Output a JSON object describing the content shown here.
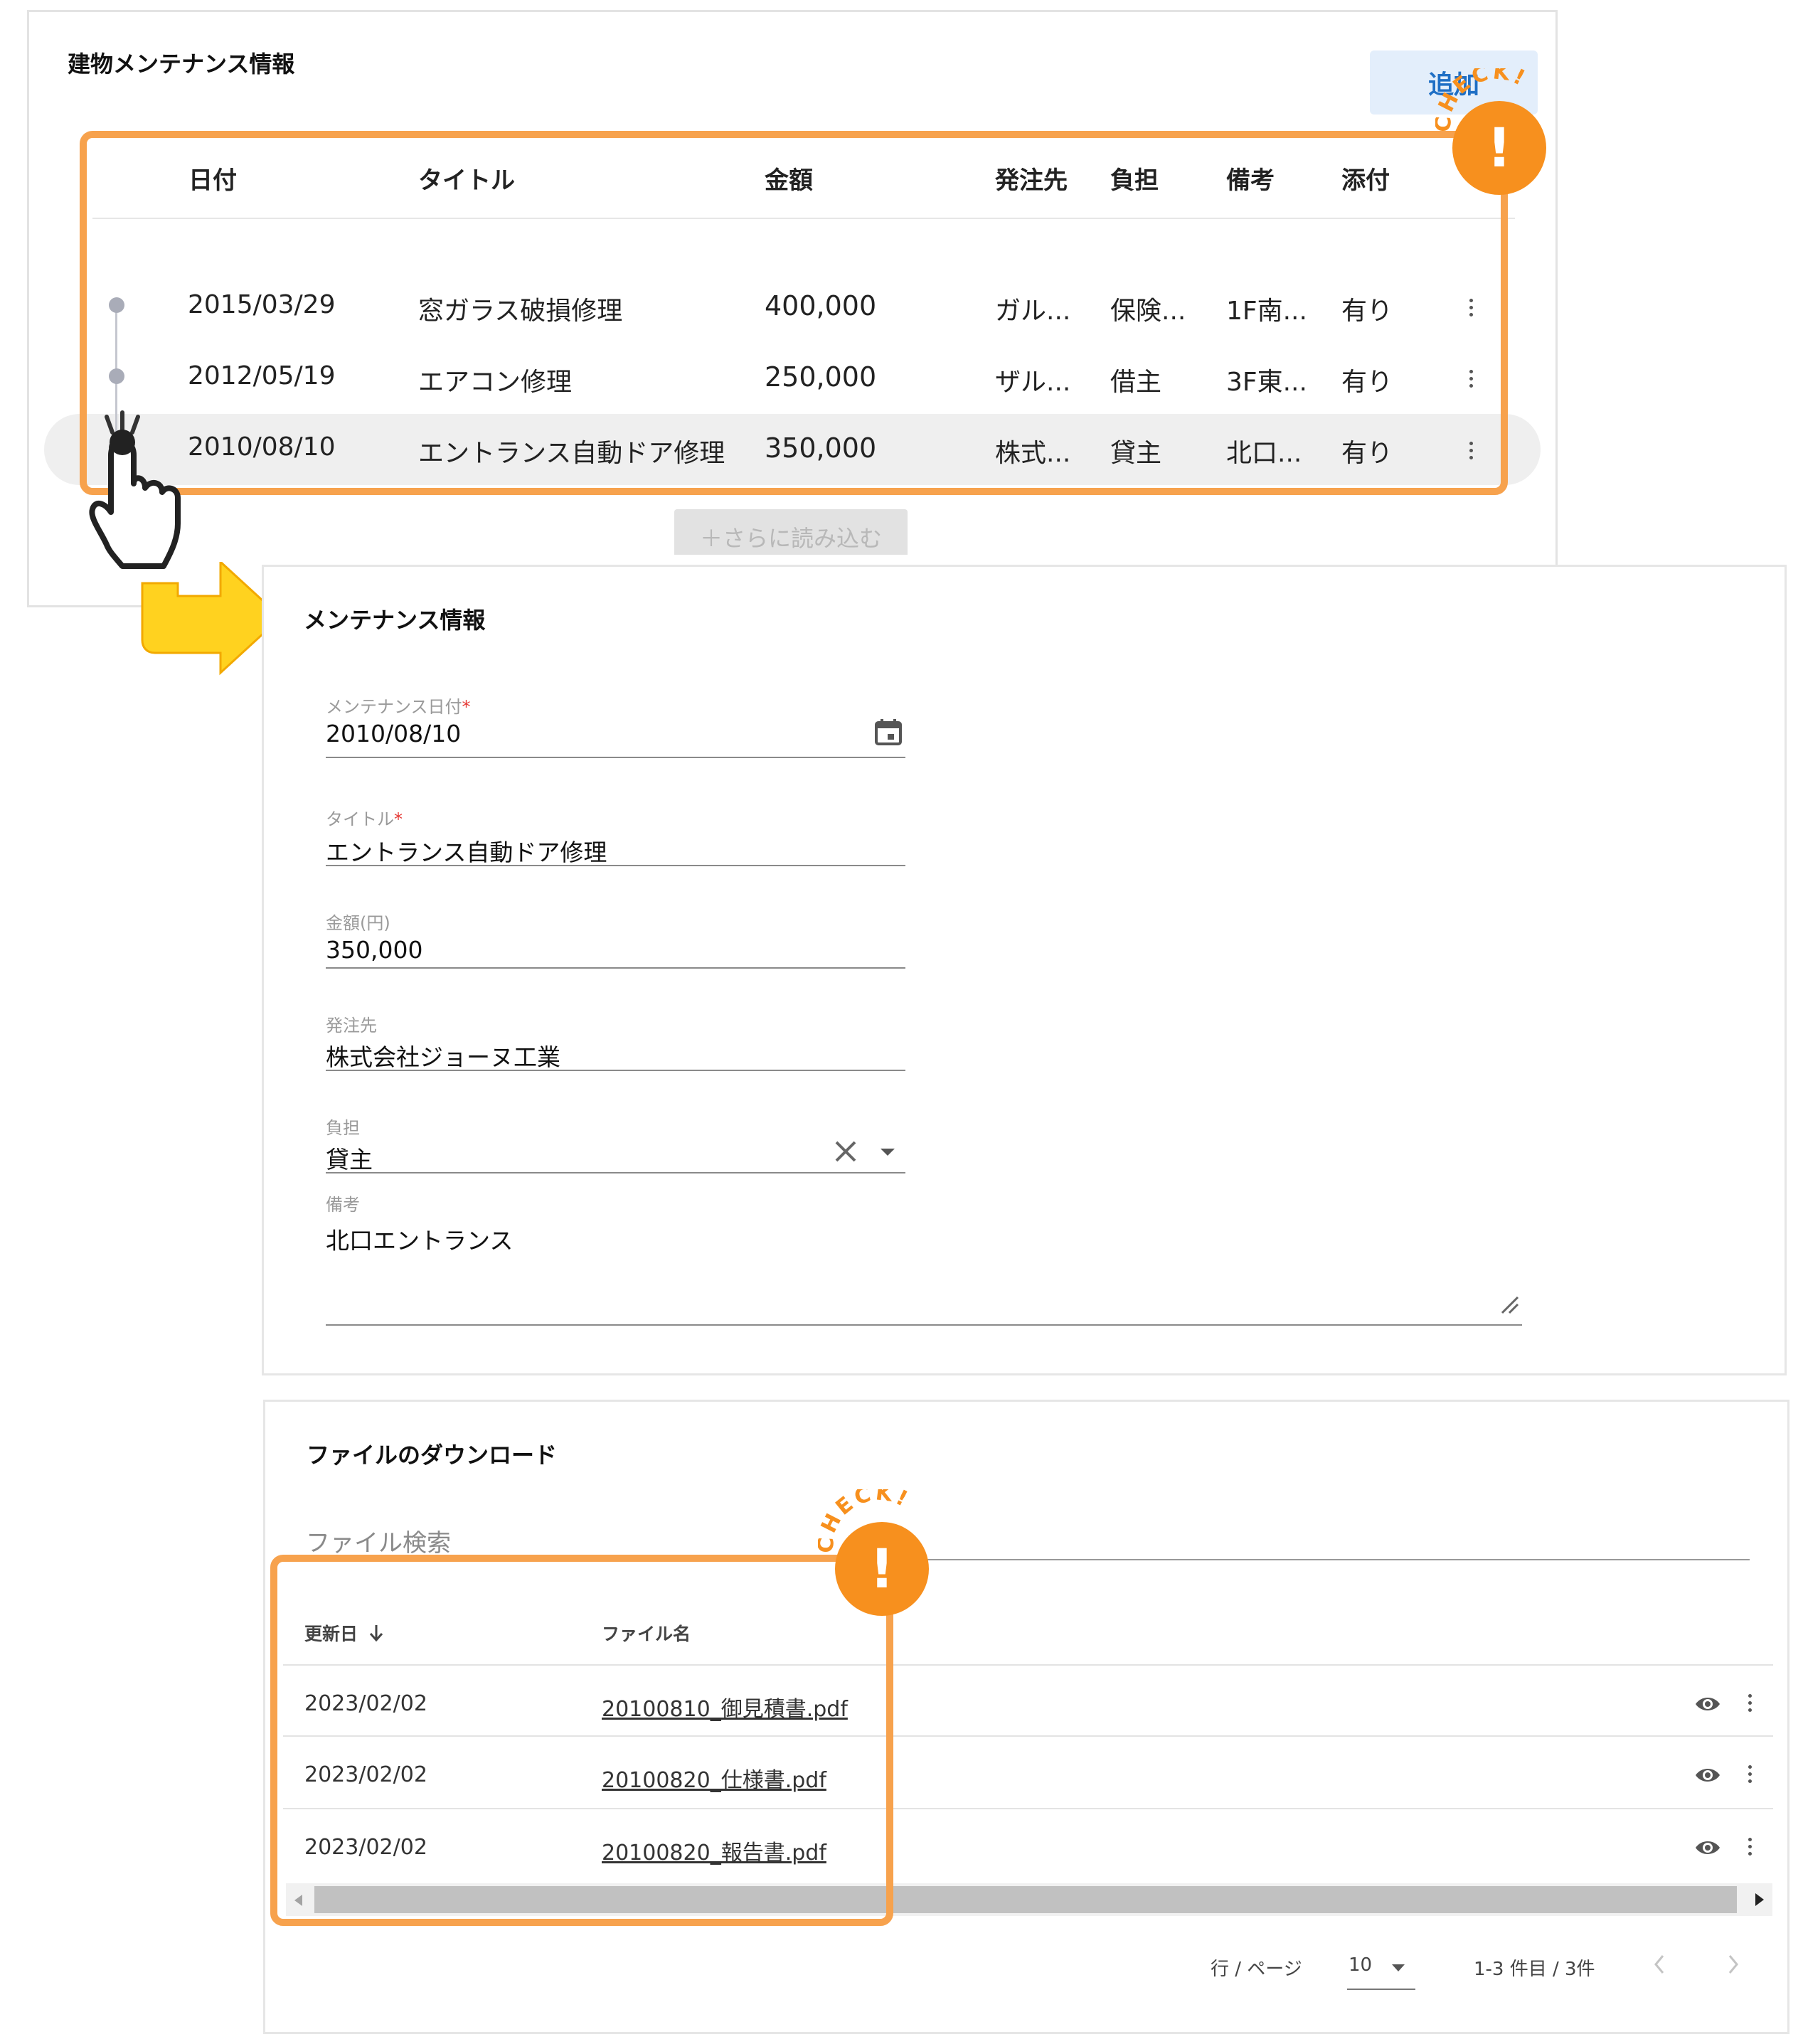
{
  "maintenance_list": {
    "title": "建物メンテナンス情報",
    "add_label": "追加",
    "columns": [
      "日付",
      "タイトル",
      "金額",
      "発注先",
      "負担",
      "備考",
      "添付"
    ],
    "rows": [
      {
        "date": "2015/03/29",
        "title": "窓ガラス破損修理",
        "amount": "400,000",
        "vendor": "ガル...",
        "burden": "保険...",
        "note": "1F南...",
        "attachment": "有り"
      },
      {
        "date": "2012/05/19",
        "title": "エアコン修理",
        "amount": "250,000",
        "vendor": "ザル...",
        "burden": "借主",
        "note": "3F東...",
        "attachment": "有り"
      },
      {
        "date": "2010/08/10",
        "title": "エントランス自動ドア修理",
        "amount": "350,000",
        "vendor": "株式...",
        "burden": "貸主",
        "note": "北口...",
        "attachment": "有り"
      }
    ],
    "load_more_label": "＋さらに読み込む"
  },
  "check_badge": {
    "text": "CHECK!",
    "mark": "!"
  },
  "detail": {
    "title": "メンテナンス情報",
    "date_label": "メンテナンス日付",
    "date_value": "2010/08/10",
    "title_label": "タイトル",
    "title_value": "エントランス自動ドア修理",
    "amount_label": "金額(円)",
    "amount_value": "350,000",
    "vendor_label": "発注先",
    "vendor_value": "株式会社ジョーヌ工業",
    "burden_label": "負担",
    "burden_value": "貸主",
    "note_label": "備考",
    "note_value": "北口エントランス",
    "required_mark": "*"
  },
  "files": {
    "title": "ファイルのダウンロード",
    "search_placeholder": "ファイル検索",
    "col_updated": "更新日",
    "col_filename": "ファイル名",
    "rows": [
      {
        "date": "2023/02/02",
        "name": "20100810_御見積書.pdf"
      },
      {
        "date": "2023/02/02",
        "name": "20100820_仕様書.pdf"
      },
      {
        "date": "2023/02/02",
        "name": "20100820_報告書.pdf"
      }
    ],
    "rows_per_page_label": "行 / ページ",
    "rows_per_page_value": "10",
    "range_text": "1-3 件目 / 3件"
  },
  "colors": {
    "accent_orange": "#f7a24d",
    "badge_orange": "#f7901e",
    "link_blue": "#1f6fc5",
    "arrow_yellow": "#ffd21f"
  }
}
